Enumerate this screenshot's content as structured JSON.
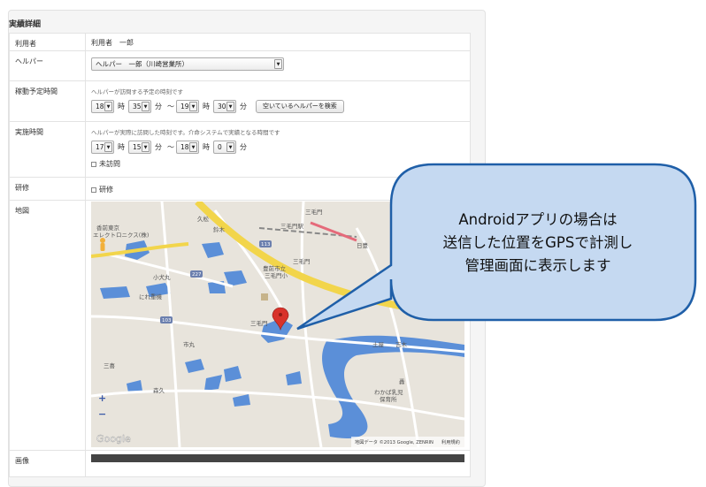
{
  "panel": {
    "title": "実績詳細"
  },
  "rows": {
    "user": {
      "label": "利用者",
      "value": "利用者　一郎"
    },
    "helper": {
      "label": "ヘルパー",
      "selected": "ヘルパー　一郎（川崎営業所）"
    },
    "planned": {
      "label": "稼動予定時間",
      "hint": "ヘルパーが訪問する予定の時刻です",
      "start_hour": "18",
      "start_min": "35",
      "end_hour": "19",
      "end_min": "30",
      "hour_unit": "時",
      "min_unit": "分",
      "tilde": "〜",
      "search_button": "空いているヘルパーを検索"
    },
    "actual": {
      "label": "実施時間",
      "hint": "ヘルパーが実際に訪問した時刻です。介命システムで実績となる時間です",
      "start_hour": "17",
      "start_min": "15",
      "end_hour": "18",
      "end_min": "0",
      "hour_unit": "時",
      "min_unit": "分",
      "tilde": "〜",
      "not_visited": "未訪問"
    },
    "training": {
      "label": "研修",
      "checkbox": "研修"
    },
    "map": {
      "label": "地図",
      "places": {
        "p1": "香前東京",
        "p2": "エレクトロニクス(株)",
        "p3": "小犬丸",
        "p4": "にれ重機",
        "p5": "三毛門駅",
        "p6": "三毛門",
        "p7": "豊前市立",
        "p8": "三毛門小",
        "p9": "三毛門",
        "p10": "市丸",
        "p11": "森久",
        "p12": "土屋",
        "p13": "吉木",
        "p14": "わかば乳児",
        "p15": "保育所",
        "p16": "三毛門",
        "p17": "日豊",
        "p18": "久松",
        "p19": "鈴木",
        "p20": "三喜",
        "p21": "轟"
      },
      "route_numbers": {
        "r1": "113",
        "r2": "227",
        "r3": "103"
      },
      "zoom_in": "+",
      "zoom_out": "−",
      "google_logo": "Google",
      "attribution": "地図データ ©2013 Google, ZENRIN",
      "terms": "利用規約"
    },
    "image": {
      "label": "画像"
    }
  },
  "callout": {
    "lines": [
      "Androidアプリの場合は",
      "送信した位置をGPSで計測し",
      "管理画面に表示します"
    ],
    "fill": "#c5d9f1",
    "stroke": "#1f5fa8"
  },
  "colors": {
    "map_bg": "#e8e4dc",
    "water": "#5b8fd8",
    "highway": "#f2d54b",
    "road": "#ffffff",
    "pin": "#d8322a"
  }
}
